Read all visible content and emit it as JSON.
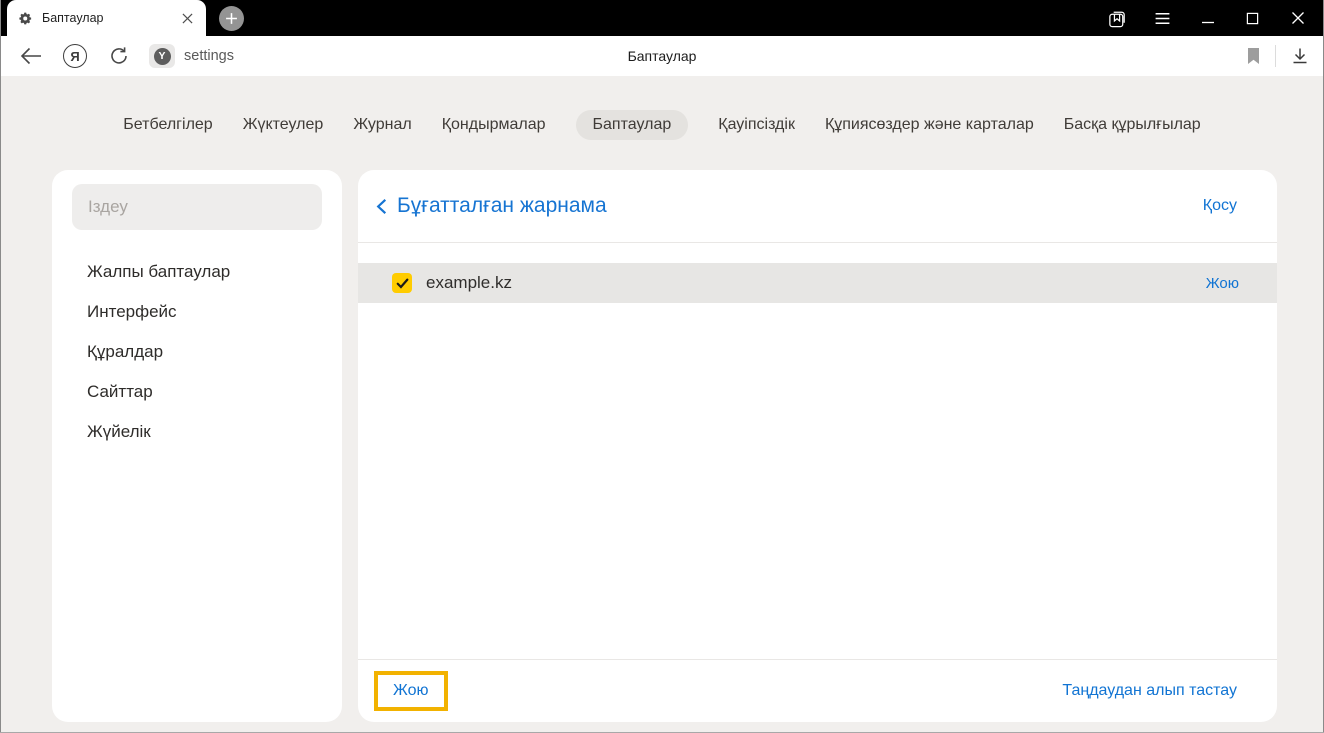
{
  "colors": {
    "accent_blue": "#1174d3",
    "checkbox_yellow": "#ffcc00",
    "highlight_border": "#f2b200",
    "tabbar_bg": "#000000",
    "page_bg": "#f1efed",
    "row_bg": "#e7e6e4",
    "selected_pill_bg": "#e4e2df"
  },
  "tabbar": {
    "tab_title": "Баптаулар",
    "tab_favicon": "gear-icon",
    "new_tab_icon": "plus-icon",
    "window_icons": [
      "side-panel-icon",
      "menu-icon",
      "minimize-icon",
      "maximize-icon",
      "close-icon"
    ]
  },
  "toolbar": {
    "url_text": "settings",
    "page_title": "Баптаулар",
    "yandex_logo_letter": "Я",
    "protect_badge_letter": "Y",
    "left_icons": [
      "back-icon",
      "yandex-logo",
      "refresh-icon",
      "protect-badge-icon"
    ],
    "right_icons": [
      "bookmark-icon",
      "download-icon"
    ]
  },
  "nav_tabs": {
    "items": [
      {
        "label": "Бетбелгілер",
        "selected": false
      },
      {
        "label": "Жүктеулер",
        "selected": false
      },
      {
        "label": "Журнал",
        "selected": false
      },
      {
        "label": "Қондырмалар",
        "selected": false
      },
      {
        "label": "Баптаулар",
        "selected": true
      },
      {
        "label": "Қауіпсіздік",
        "selected": false
      },
      {
        "label": "Құпиясөздер және карталар",
        "selected": false
      },
      {
        "label": "Басқа құрылғылар",
        "selected": false
      }
    ]
  },
  "sidebar": {
    "search_placeholder": "Іздеу",
    "items": [
      "Жалпы баптаулар",
      "Интерфейс",
      "Құралдар",
      "Сайттар",
      "Жүйелік"
    ]
  },
  "main": {
    "title": "Бұғатталған жарнама",
    "add_link": "Қосу",
    "rows": [
      {
        "checked": true,
        "domain": "example.kz",
        "remove_link": "Жою"
      }
    ],
    "footer": {
      "delete_button": "Жою",
      "deselect_link": "Таңдаудан алып тастау"
    }
  }
}
